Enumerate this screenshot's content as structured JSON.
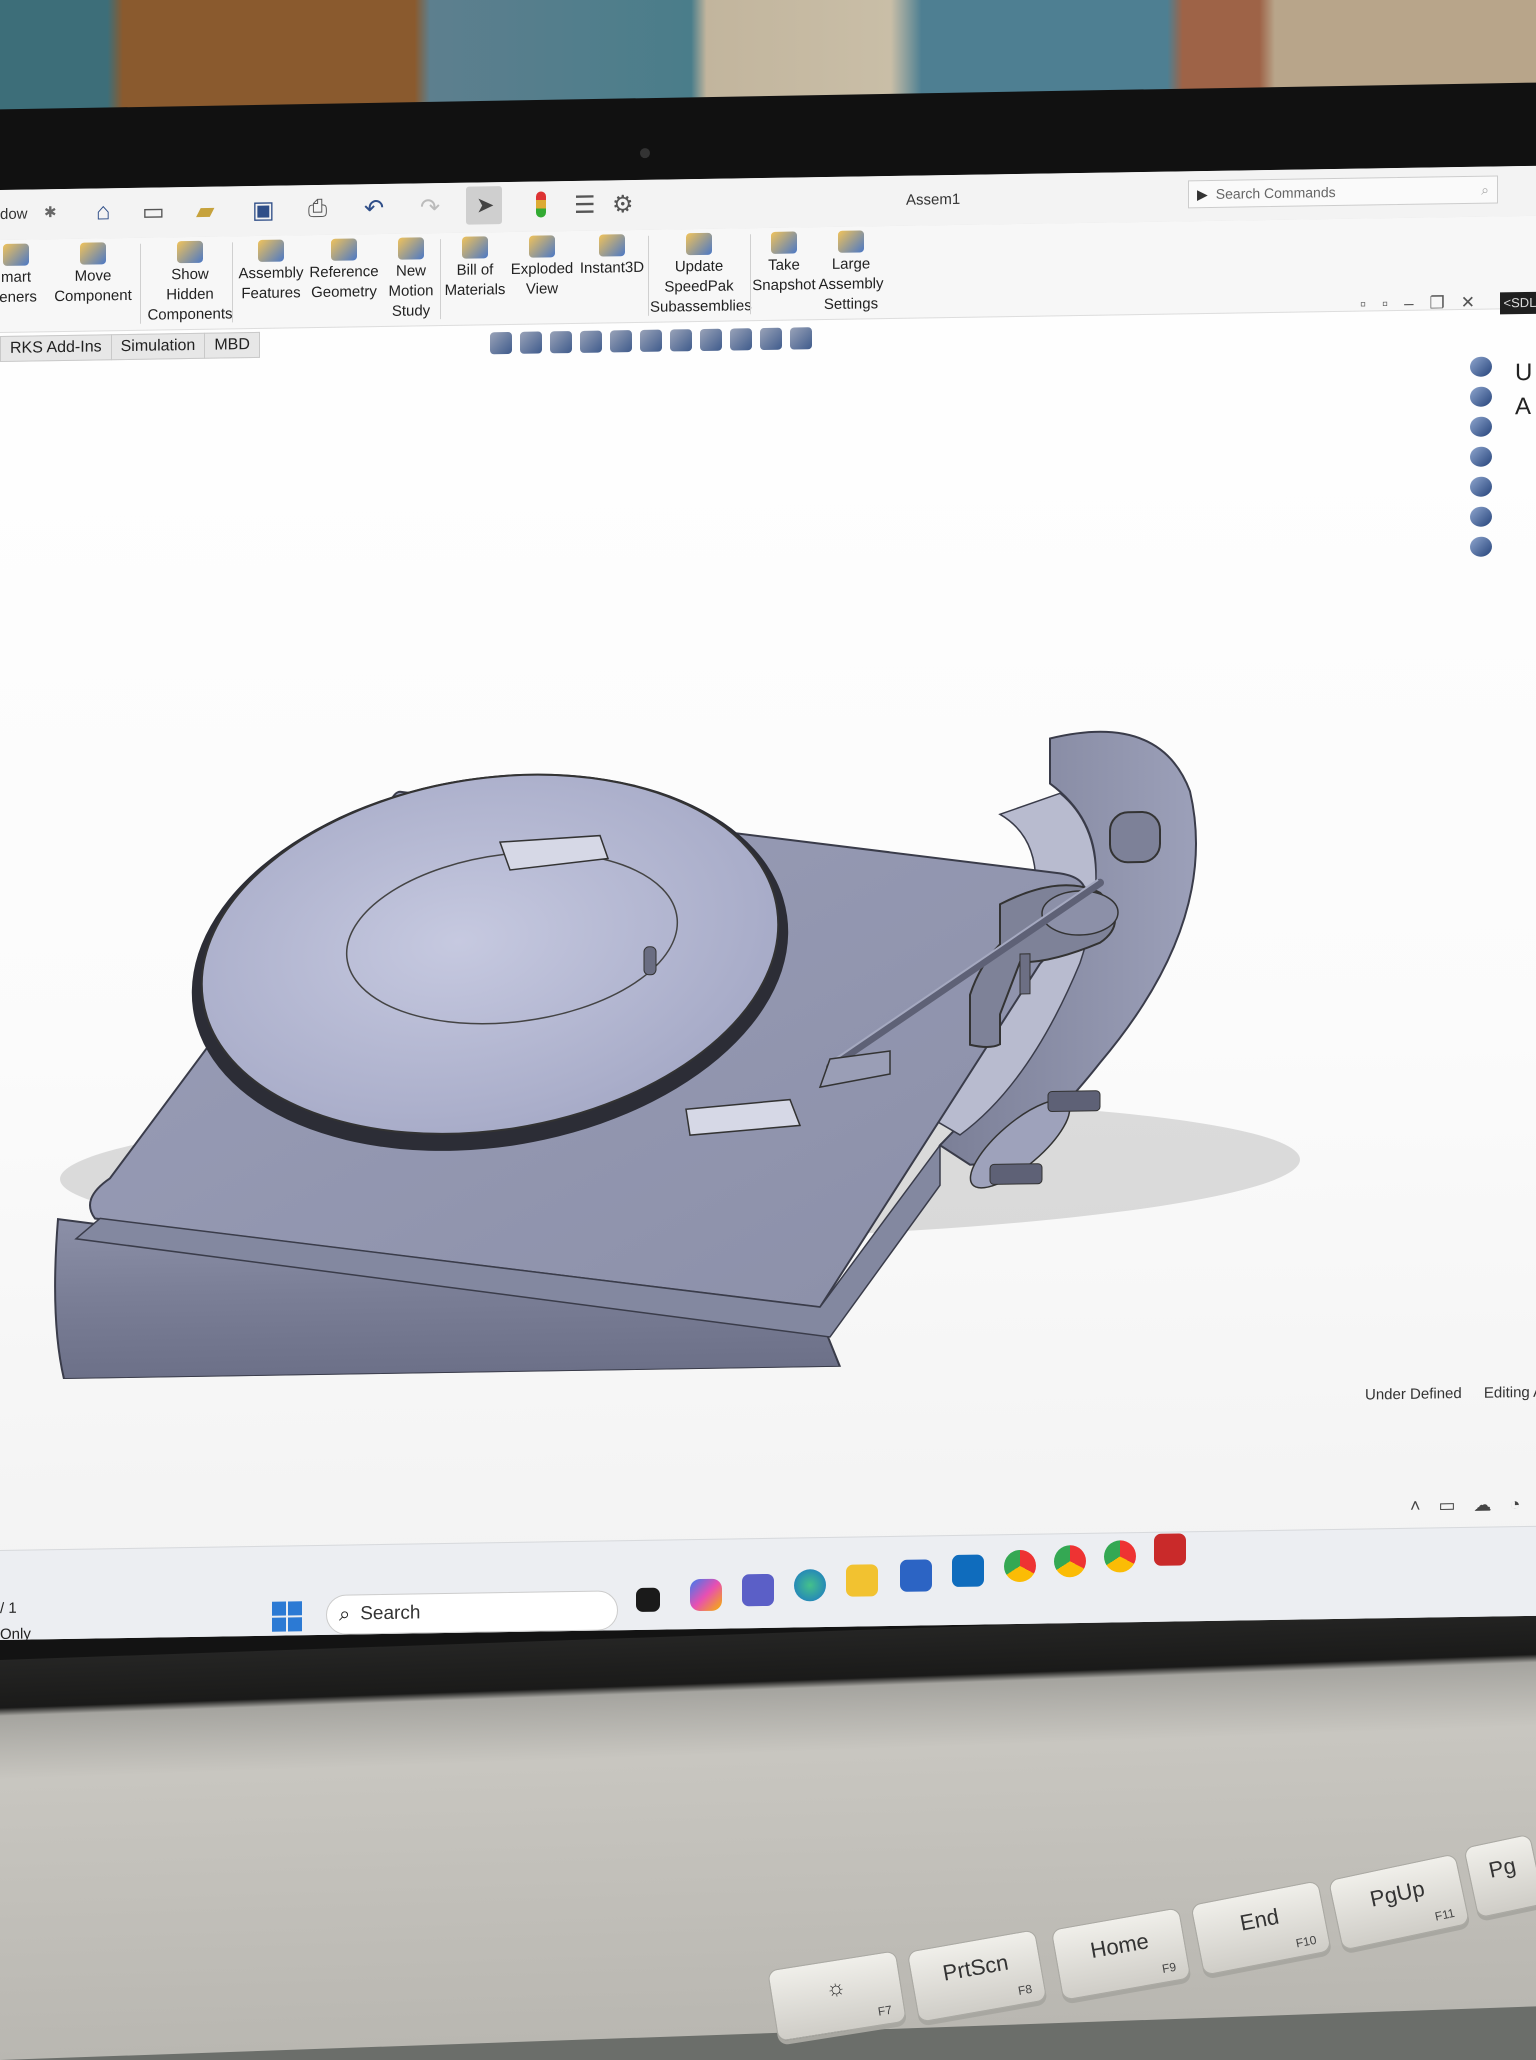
{
  "app": {
    "title": "Assem1",
    "menu_fragment": "dow",
    "search_placeholder": "Search Commands",
    "command_manager": "<SDL"
  },
  "ribbon": [
    {
      "label": "mart\nteners"
    },
    {
      "label": "Move\nComponent"
    },
    {
      "label": "Show\nHidden\nComponents"
    },
    {
      "label": "Assembly\nFeatures"
    },
    {
      "label": "Reference\nGeometry"
    },
    {
      "label": "New\nMotion\nStudy"
    },
    {
      "label": "Bill of\nMaterials"
    },
    {
      "label": "Exploded\nView"
    },
    {
      "label": "Instant3D"
    },
    {
      "label": "Update\nSpeedPak\nSubassemblies"
    },
    {
      "label": "Take\nSnapshot"
    },
    {
      "label": "Large\nAssembly\nSettings"
    }
  ],
  "tabs": [
    "RKS Add-Ins",
    "Simulation",
    "MBD"
  ],
  "task_pane_text": [
    "U",
    "A"
  ],
  "status": {
    "state": "Under Defined",
    "mode": "Editing Ass",
    "page": "/ 1",
    "readonly": "Only"
  },
  "taskbar": {
    "search_label": "Search"
  },
  "keyboard": [
    {
      "main": "PrtScn",
      "fn": "F8"
    },
    {
      "main": "Home",
      "fn": "F9"
    },
    {
      "main": "End",
      "fn": "F10"
    },
    {
      "main": "PgUp",
      "fn": "F11"
    },
    {
      "main": "Pg",
      "fn": ""
    },
    {
      "main": "☼",
      "fn": "F7"
    }
  ],
  "colors": {
    "model_body": "#8f93ab",
    "model_shade": "#6f7389",
    "platter": "#b5b9d4",
    "taskbar": "#eceef2",
    "accent": "#2c7ad4"
  }
}
